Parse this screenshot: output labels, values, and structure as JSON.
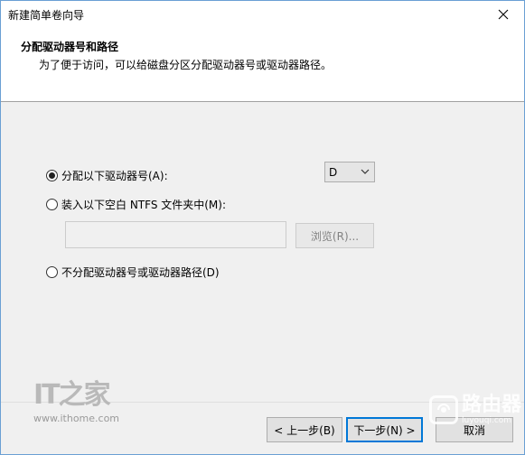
{
  "window": {
    "title": "新建简单卷向导"
  },
  "header": {
    "title": "分配驱动器号和路径",
    "description": "为了便于访问，可以给磁盘分区分配驱动器号或驱动器路径。"
  },
  "options": {
    "assign_letter": {
      "label": "分配以下驱动器号(A):",
      "checked": true
    },
    "mount_folder": {
      "label": "装入以下空白 NTFS 文件夹中(M):",
      "checked": false
    },
    "no_assign": {
      "label": "不分配驱动器号或驱动器路径(D)",
      "checked": false
    }
  },
  "drive_letter_select": {
    "value": "D"
  },
  "folder_path": {
    "value": "",
    "browse_label": "浏览(R)..."
  },
  "buttons": {
    "back": "< 上一步(B)",
    "next": "下一步(N) >",
    "cancel": "取消"
  },
  "watermarks": {
    "ithome_logo": "IT之家",
    "ithome_site": "www.ithome.com",
    "router_cn": "路由器",
    "router_en": "luyouqi.com"
  },
  "colors": {
    "window_border": "#6a9fd4",
    "default_button_border": "#0078d7",
    "dialog_background": "#f0f0f0"
  }
}
